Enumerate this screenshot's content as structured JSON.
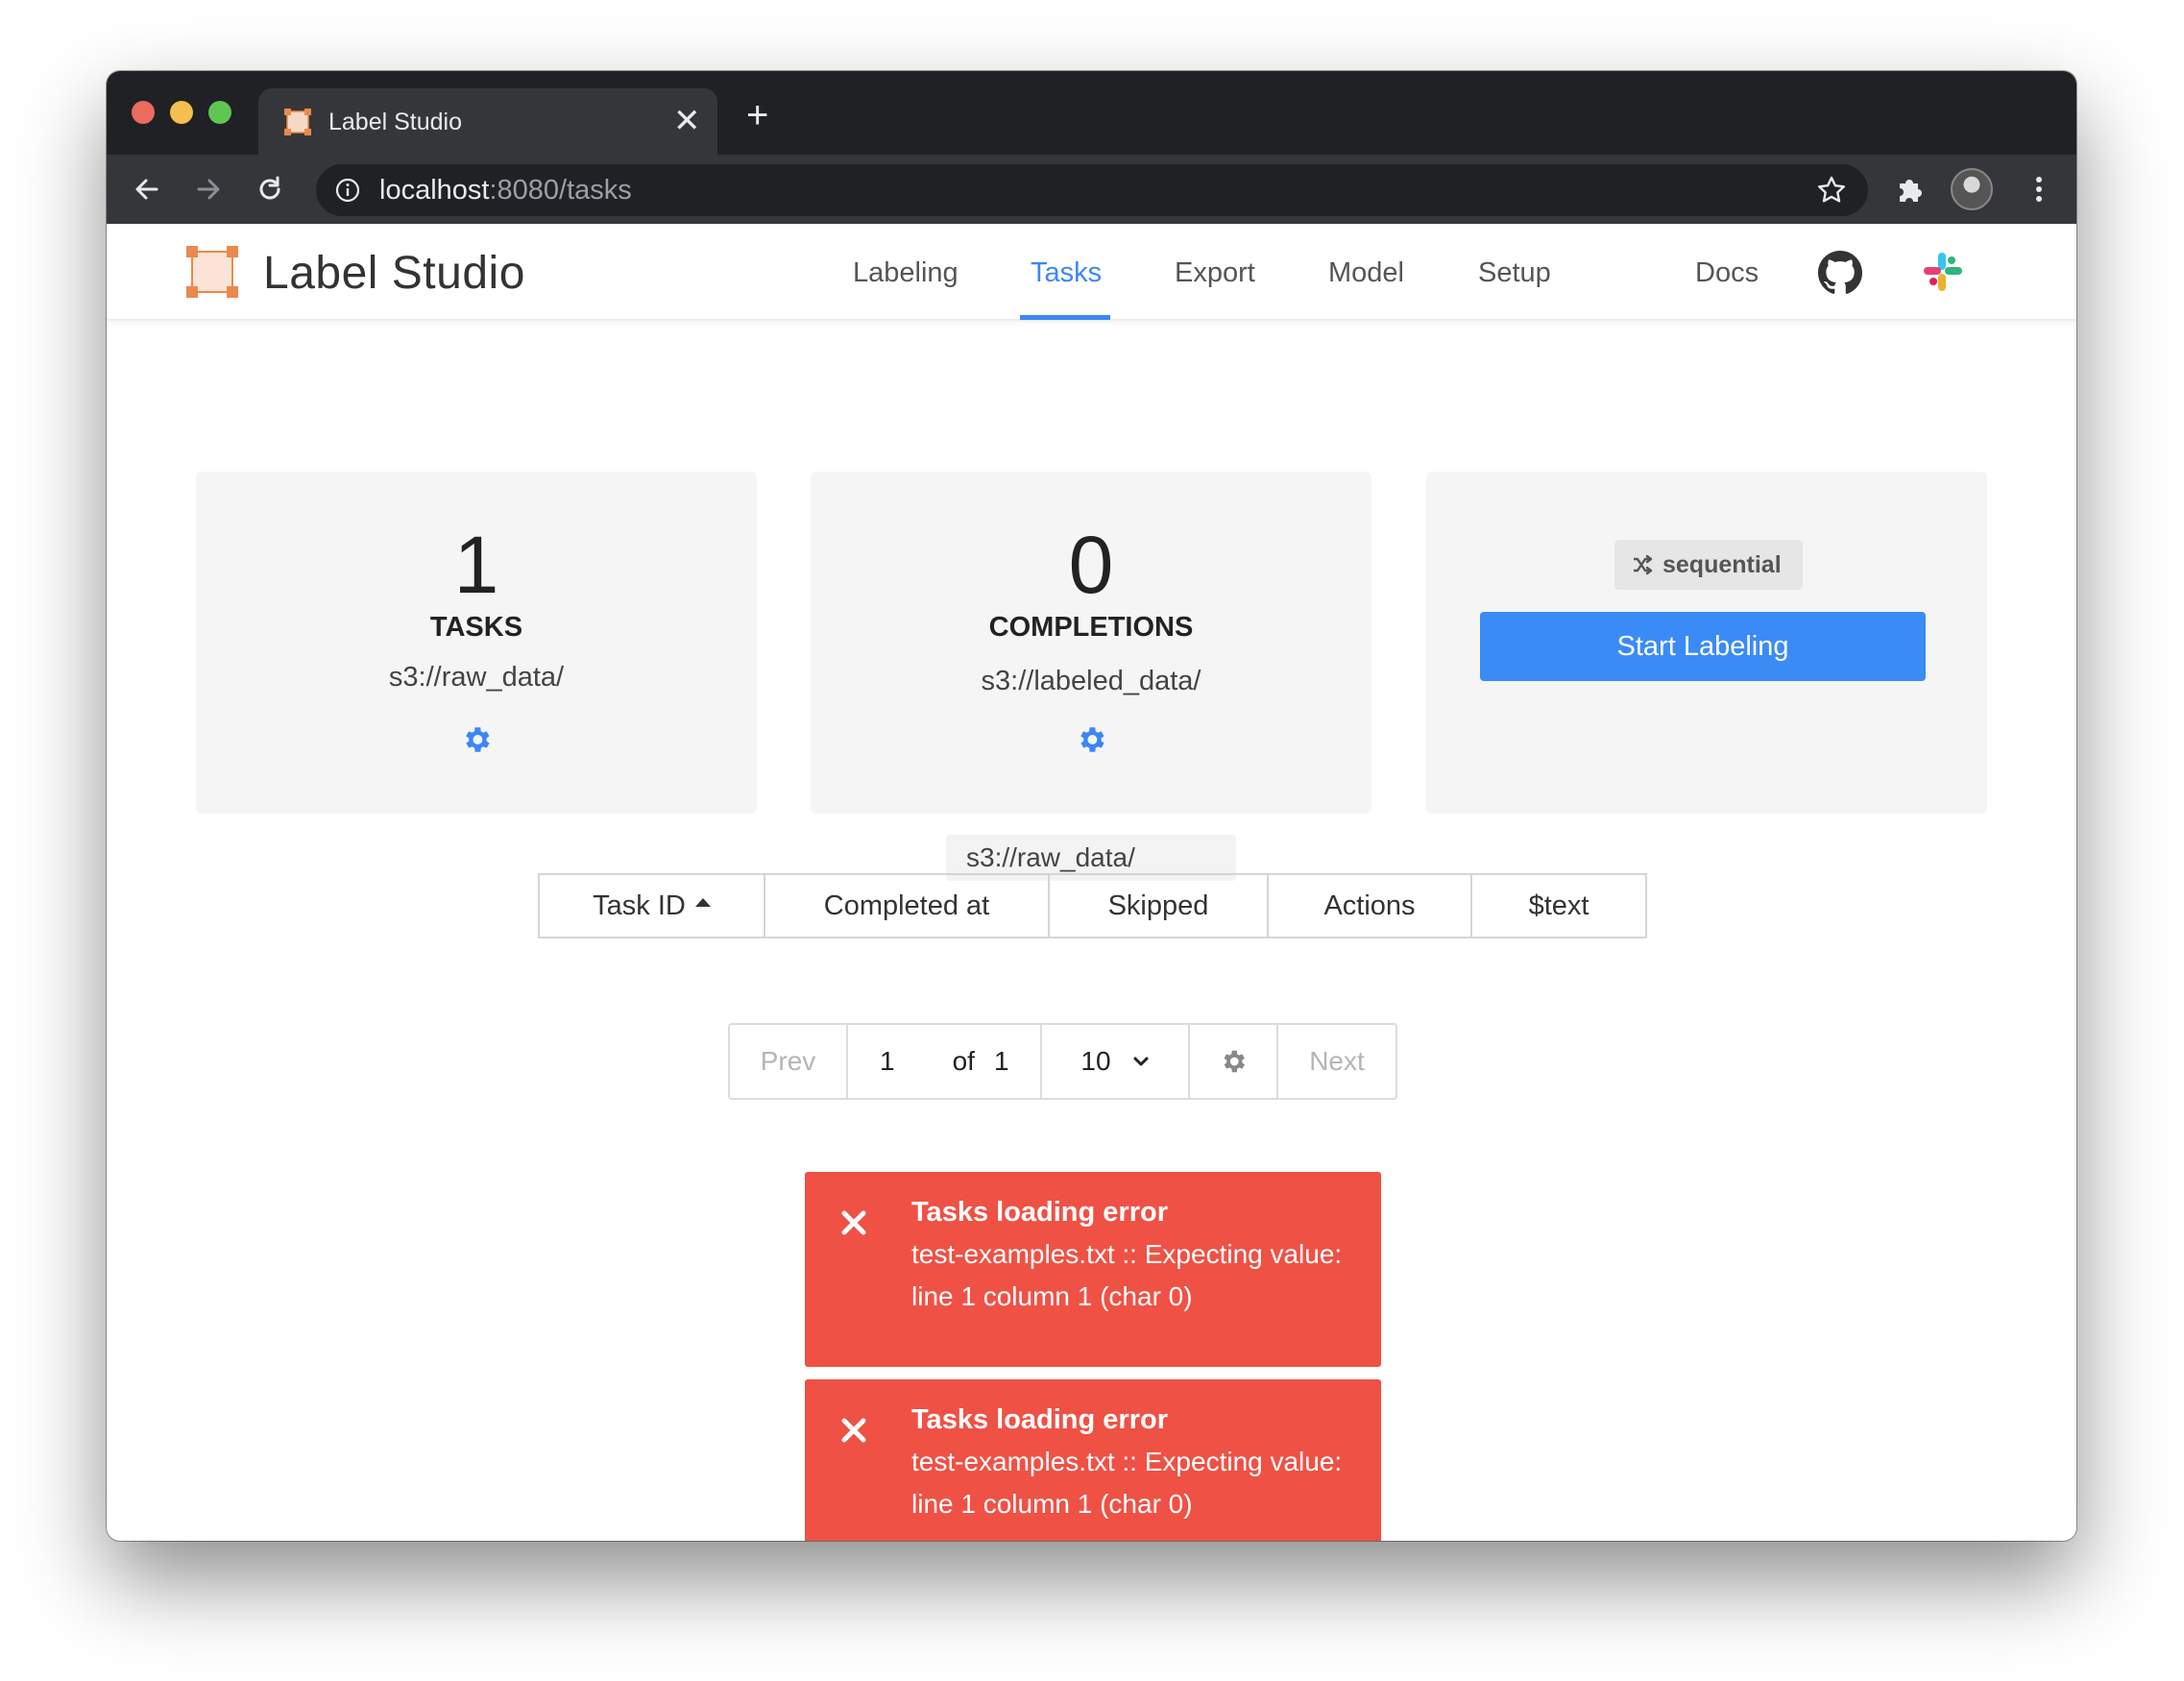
{
  "browser": {
    "tab_title": "Label Studio",
    "url_host": "localhost",
    "url_rest": ":8080/tasks"
  },
  "header": {
    "brand": "Label Studio",
    "nav": [
      {
        "label": "Labeling"
      },
      {
        "label": "Tasks",
        "active": true
      },
      {
        "label": "Export"
      },
      {
        "label": "Model"
      },
      {
        "label": "Setup"
      },
      {
        "label": "Docs"
      }
    ],
    "accent_color": "#3b86f7"
  },
  "cards": {
    "tasks": {
      "count": "1",
      "label": "TASKS",
      "path": "s3://raw_data/"
    },
    "completions": {
      "count": "0",
      "label": "COMPLETIONS",
      "path": "s3://labeled_data/"
    },
    "labeling": {
      "mode": "sequential",
      "start_label": "Start Labeling"
    }
  },
  "table": {
    "tooltip": "s3://raw_data/",
    "columns": [
      "Task ID",
      "Completed at",
      "Skipped",
      "Actions",
      "$text"
    ]
  },
  "pagination": {
    "prev": "Prev",
    "page": "1",
    "of": "of",
    "total_pages": "1",
    "page_size": "10",
    "next": "Next"
  },
  "errors": [
    {
      "title": "Tasks loading error",
      "line1": "test-examples.txt :: Expecting value:",
      "line2": "line 1 column 1 (char 0)"
    },
    {
      "title": "Tasks loading error",
      "line1": "test-examples.txt :: Expecting value:",
      "line2": "line 1 column 1 (char 0)"
    }
  ],
  "colors": {
    "error": "#ef5145",
    "primary_button": "#3b8bf7",
    "card_bg": "#f5f5f5"
  }
}
